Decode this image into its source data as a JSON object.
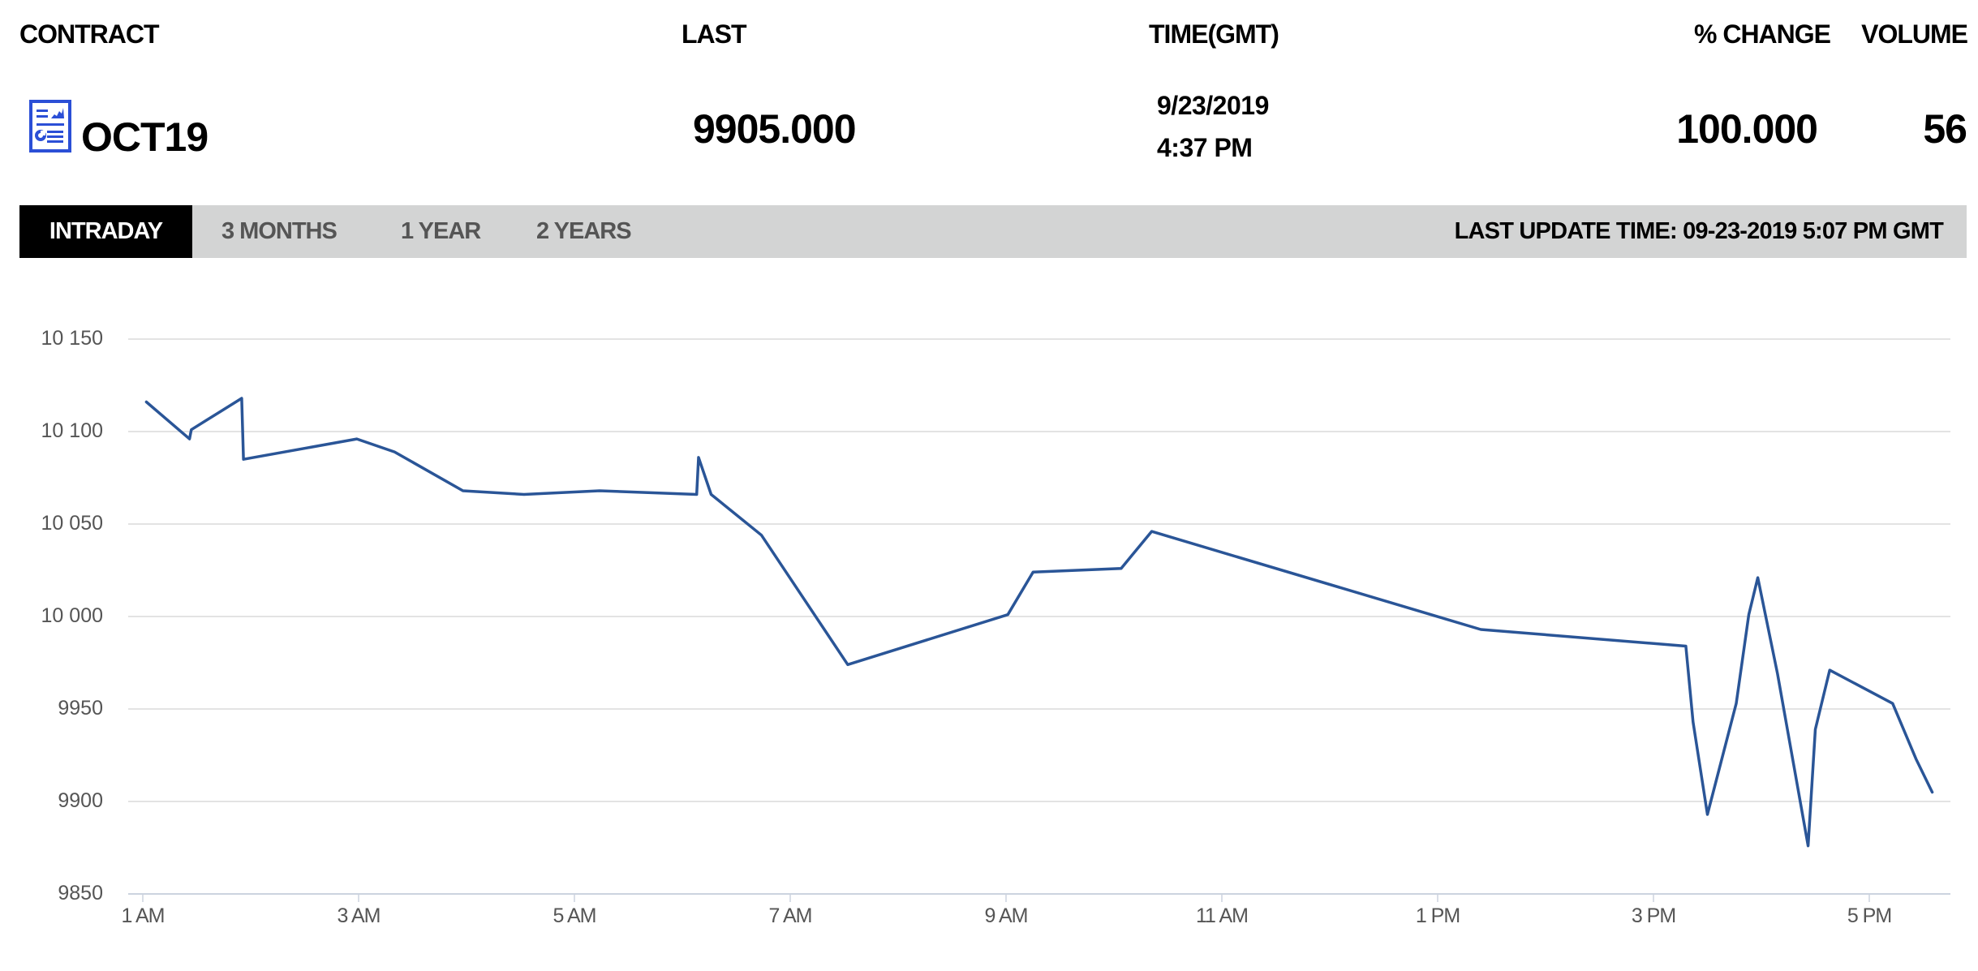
{
  "header": {
    "labels": {
      "contract": "CONTRACT",
      "last": "LAST",
      "time": "TIME(GMT)",
      "pct_change": "% CHANGE",
      "volume": "VOLUME"
    },
    "contract": {
      "name": "OCT19",
      "icon": "report-document-icon",
      "icon_color": "#2b4fd6"
    },
    "last": "9905.000",
    "date": "9/23/2019",
    "time": "4:37 PM",
    "pct_change": "100.000",
    "volume": "56"
  },
  "tabs": [
    {
      "label": "INTRADAY",
      "active": true
    },
    {
      "label": "3 MONTHS",
      "active": false
    },
    {
      "label": "1 YEAR",
      "active": false
    },
    {
      "label": "2 YEARS",
      "active": false
    }
  ],
  "last_update": "LAST UPDATE TIME: 09-23-2019 5:07 PM GMT",
  "colors": {
    "line": "#2a5597",
    "tab_bar_bg": "#d3d4d4",
    "tab_active_bg": "#000000",
    "grid": "#e3e3e3",
    "axis": "#ccd3df"
  },
  "chart_data": {
    "type": "line",
    "title": "",
    "xlabel": "",
    "ylabel": "",
    "x_unit": "time of day (GMT), 9/23/2019",
    "xlim": [
      "00:55",
      "17:50"
    ],
    "ylim": [
      9850,
      10150
    ],
    "grid": true,
    "legend": "none",
    "y_ticks": [
      {
        "value": 10150,
        "label": "10 150"
      },
      {
        "value": 10100,
        "label": "10 100"
      },
      {
        "value": 10050,
        "label": "10 050"
      },
      {
        "value": 10000,
        "label": "10 000"
      },
      {
        "value": 9950,
        "label": "9950"
      },
      {
        "value": 9900,
        "label": "9900"
      },
      {
        "value": 9850,
        "label": "9850"
      }
    ],
    "x_ticks": [
      {
        "time": "01:00",
        "label": "1 AM"
      },
      {
        "time": "03:00",
        "label": "3 AM"
      },
      {
        "time": "05:00",
        "label": "5 AM"
      },
      {
        "time": "07:00",
        "label": "7 AM"
      },
      {
        "time": "09:00",
        "label": "9 AM"
      },
      {
        "time": "11:00",
        "label": "11 AM"
      },
      {
        "time": "13:00",
        "label": "1 PM"
      },
      {
        "time": "15:00",
        "label": "3 PM"
      },
      {
        "time": "17:00",
        "label": "5 PM"
      }
    ],
    "series": [
      {
        "name": "OCT19",
        "points": [
          {
            "t": "01:02",
            "v": 10116
          },
          {
            "t": "01:26",
            "v": 10096
          },
          {
            "t": "01:27",
            "v": 10101
          },
          {
            "t": "01:55",
            "v": 10118
          },
          {
            "t": "01:56",
            "v": 10085
          },
          {
            "t": "02:59",
            "v": 10096
          },
          {
            "t": "03:20",
            "v": 10089
          },
          {
            "t": "03:58",
            "v": 10068
          },
          {
            "t": "04:32",
            "v": 10066
          },
          {
            "t": "05:14",
            "v": 10068
          },
          {
            "t": "06:08",
            "v": 10066
          },
          {
            "t": "06:09",
            "v": 10086
          },
          {
            "t": "06:16",
            "v": 10066
          },
          {
            "t": "06:44",
            "v": 10044
          },
          {
            "t": "07:32",
            "v": 9974
          },
          {
            "t": "09:01",
            "v": 10001
          },
          {
            "t": "09:15",
            "v": 10024
          },
          {
            "t": "10:04",
            "v": 10026
          },
          {
            "t": "10:21",
            "v": 10046
          },
          {
            "t": "13:24",
            "v": 9993
          },
          {
            "t": "15:18",
            "v": 9984
          },
          {
            "t": "15:22",
            "v": 9943
          },
          {
            "t": "15:30",
            "v": 9893
          },
          {
            "t": "15:46",
            "v": 9953
          },
          {
            "t": "15:53",
            "v": 10001
          },
          {
            "t": "15:58",
            "v": 10021
          },
          {
            "t": "16:09",
            "v": 9969
          },
          {
            "t": "16:26",
            "v": 9876
          },
          {
            "t": "16:30",
            "v": 9939
          },
          {
            "t": "16:38",
            "v": 9971
          },
          {
            "t": "17:13",
            "v": 9953
          },
          {
            "t": "17:26",
            "v": 9923
          },
          {
            "t": "17:35",
            "v": 9905
          }
        ]
      }
    ]
  }
}
